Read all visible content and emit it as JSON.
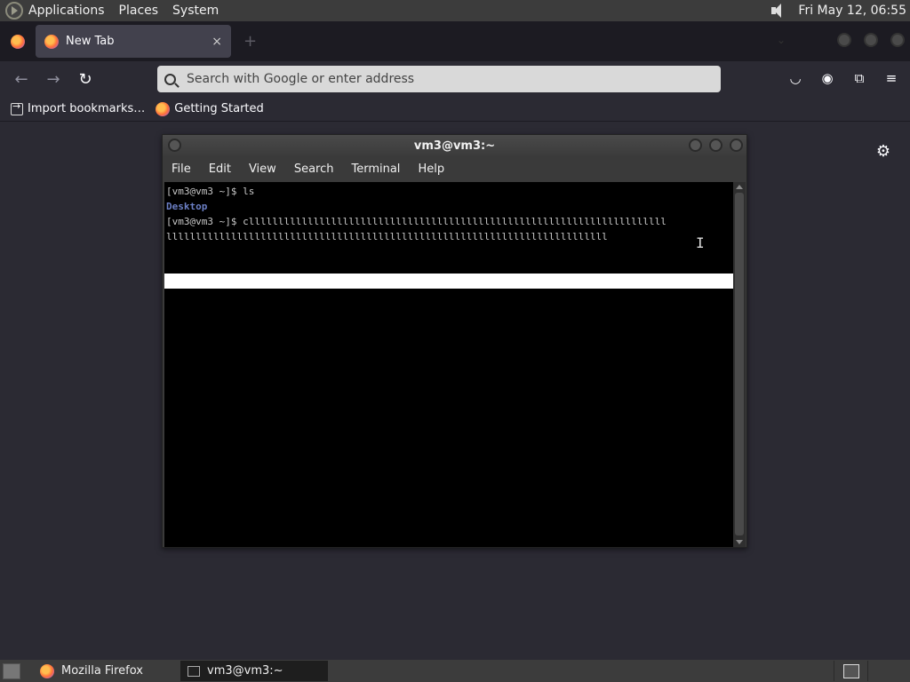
{
  "top_panel": {
    "menus": [
      "Applications",
      "Places",
      "System"
    ],
    "clock": "Fri May 12, 06:55"
  },
  "firefox": {
    "tab": {
      "title": "New Tab",
      "close": "×"
    },
    "newtab": "+",
    "urlbar": {
      "placeholder": "Search with Google or enter address"
    },
    "bookmarks": [
      {
        "label": "Import bookmarks…",
        "icon": "import-icon"
      },
      {
        "label": "Getting Started",
        "icon": "firefox-icon"
      }
    ]
  },
  "terminal": {
    "title": "vm3@vm3:~",
    "menus": [
      "File",
      "Edit",
      "View",
      "Search",
      "Terminal",
      "Help"
    ],
    "lines": {
      "line1": "[vm3@vm3 ~]$ ls",
      "line2": "Desktop",
      "line3": "[vm3@vm3 ~]$ clllllllllllllllllllllllllllllllllllllllllllllllllllllllllllllllllllllll",
      "line4": "lllllllllllllllllllllllllllllllllllllllllllllllllllllllllllllllllllllllllll"
    }
  },
  "taskbar": {
    "tasks": [
      "Mozilla Firefox",
      "vm3@vm3:~"
    ]
  }
}
